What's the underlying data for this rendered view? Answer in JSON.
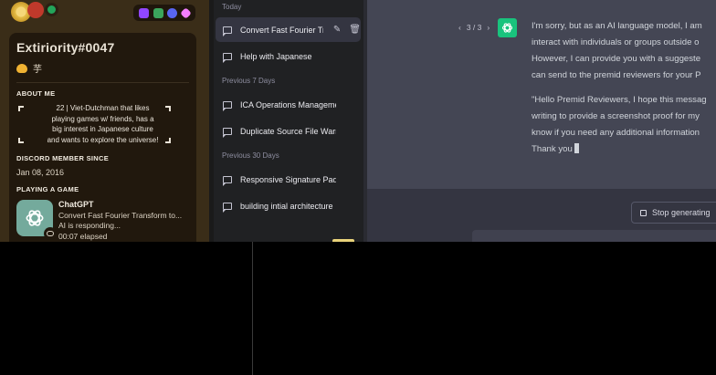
{
  "discord": {
    "username": "Extiriority#0047",
    "custom_status": "芋",
    "about_me_title": "ABOUT ME",
    "about_me_lines": [
      "22 | Viet-Dutchman that likes",
      "playing games w/ friends, has a",
      "big interest in Japanese culture",
      "and wants to explore the universe!"
    ],
    "member_since_title": "DISCORD MEMBER SINCE",
    "member_since": "Jan 08, 2016",
    "playing_title": "PLAYING A GAME",
    "game": {
      "name": "ChatGPT",
      "details": "Convert Fast Fourier Transform to...",
      "state": "AI is responding...",
      "elapsed": "00:07 elapsed"
    },
    "colors": {
      "banner": "#3a2d18",
      "card": "#21180d",
      "online": "#23a55a"
    }
  },
  "sidebar": {
    "groups": [
      {
        "label": "Today"
      },
      {
        "label": "Previous 7 Days"
      },
      {
        "label": "Previous 30 Days"
      }
    ],
    "items": [
      {
        "label": "Convert Fast Fourier Transform to",
        "active": true
      },
      {
        "label": "Help with Japanese"
      },
      {
        "label": "ICA Operations Management S"
      },
      {
        "label": "Duplicate Source File Warning"
      },
      {
        "label": "Responsive Signature Pad."
      },
      {
        "label": "building intial architecture"
      }
    ]
  },
  "chat": {
    "pager": "3 / 3",
    "pager_prev": "‹",
    "pager_next": "›",
    "paragraph1": [
      "I'm sorry, but as an AI language model, I am",
      "interact with individuals or groups outside o",
      "However, I can provide you with a suggeste",
      "can send to the premid reviewers for your P"
    ],
    "paragraph2": [
      "\"Hello Premid Reviewers, I hope this messag",
      "writing to provide a screenshot proof for my",
      "know if you need any additional information",
      "Thank you"
    ],
    "stop_label": "Stop generating",
    "colors": {
      "assistant_bg": "#444654",
      "avatar": "#19c37d",
      "page_bg": "#343541"
    }
  }
}
